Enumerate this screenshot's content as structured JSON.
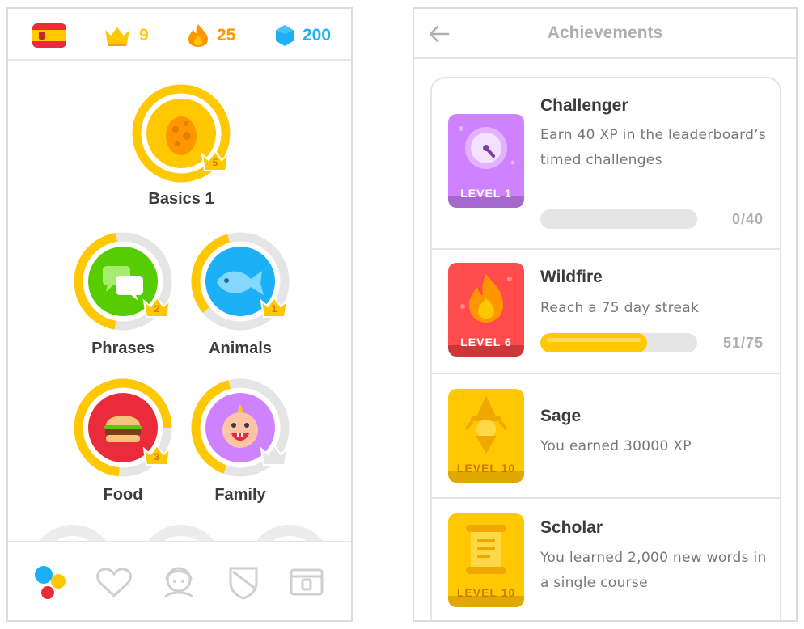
{
  "left_screen": {
    "header": {
      "flag_icon": "spain-flag",
      "crowns": "9",
      "streak": "25",
      "gems": "200"
    },
    "skills": [
      {
        "label": "Basics 1",
        "level": "5",
        "color": "#ffc800",
        "icon": "egg-icon"
      },
      {
        "label": "Phrases",
        "level": "2",
        "color": "#58cc02",
        "icon": "speech-bubbles-icon"
      },
      {
        "label": "Animals",
        "level": "1",
        "color": "#1cb0f6",
        "icon": "fish-icon"
      },
      {
        "label": "Food",
        "level": "3",
        "color": "#ea2b3a",
        "icon": "burger-icon"
      },
      {
        "label": "Family",
        "level": "",
        "color": "#ce82ff",
        "icon": "baby-icon"
      }
    ],
    "tab_bar": [
      "learn-tab-icon",
      "heart-icon",
      "profile-icon",
      "shield-icon",
      "shop-icon"
    ]
  },
  "right_screen": {
    "header": {
      "title": "Achievements",
      "back_icon": "back-arrow-icon"
    },
    "achievements": [
      {
        "name": "Challenger",
        "description": "Earn 40 XP in the leaderboard’s timed challenges",
        "badge_level": "LEVEL 1",
        "progress_text": "0/40",
        "progress": 0.0,
        "badge_color": "#ce82ff"
      },
      {
        "name": "Wildfire",
        "description": "Reach a 75 day streak",
        "badge_level": "LEVEL 6",
        "progress_text": "51/75",
        "progress": 0.68,
        "badge_color": "#ff4b4b"
      },
      {
        "name": "Sage",
        "description": "You earned 30000 XP",
        "badge_level": "LEVEL 10",
        "badge_color": "#ffc800"
      },
      {
        "name": "Scholar",
        "description": "You learned 2,000 new words in a single course",
        "badge_level": "LEVEL 10",
        "badge_color": "#ffc800"
      }
    ]
  }
}
